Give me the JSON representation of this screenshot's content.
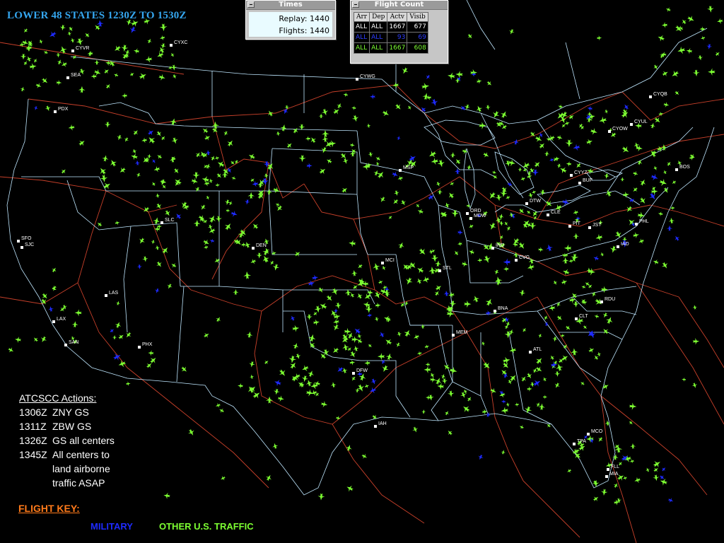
{
  "title": "LOWER 48 STATES 1230Z TO 1530Z",
  "colors": {
    "background": "#000000",
    "state_lines": "#bfe7ff",
    "center_lines": "#d2402b",
    "other_traffic": "#7dff32",
    "military": "#1e2bff",
    "title": "#35a7f0",
    "flight_key": "#ff7a1a"
  },
  "times_window": {
    "title": "Times",
    "replay_label": "Replay:",
    "replay_value": "1440",
    "flights_label": "Flights:",
    "flights_value": "1440"
  },
  "flight_count_window": {
    "title": "Flight Count",
    "headers": [
      "Arr",
      "Dep",
      "Actv",
      "Visib"
    ],
    "rows": [
      [
        "ALL",
        "ALL",
        "1667",
        "677"
      ],
      [
        "ALL",
        "ALL",
        "93",
        "69"
      ],
      [
        "ALL",
        "ALL",
        "1667",
        "608"
      ]
    ]
  },
  "airports": [
    "CYVR",
    "SEA",
    "CYXC",
    "CYWG",
    "PDX",
    "SFO",
    "SJC",
    "SLC",
    "LAS",
    "LAX",
    "SAN",
    "PHX",
    "DEN",
    "MSP",
    "ORD",
    "MDW",
    "DTW",
    "CLE",
    "PIT",
    "JST",
    "BOS",
    "PHL",
    "IAD",
    "CVG",
    "IND",
    "STL",
    "MCI",
    "BNA",
    "CLT",
    "RDU",
    "ATL",
    "MEM",
    "DFW",
    "IAH",
    "MCO",
    "TPA",
    "FLL",
    "MIA",
    "CYQB",
    "CYUL",
    "CYYZ",
    "CYOW",
    "BUF"
  ],
  "actions": {
    "title": "ATCSCC Actions:",
    "items": [
      {
        "time": "1306Z",
        "text": "ZNY GS"
      },
      {
        "time": "1311Z",
        "text": "ZBW GS"
      },
      {
        "time": "1326Z",
        "text": "GS all centers"
      },
      {
        "time": "1345Z",
        "text": "All centers to",
        "cont": [
          "land airborne",
          "traffic ASAP"
        ]
      }
    ]
  },
  "flight_key": {
    "title": "FLIGHT KEY:",
    "military": "MILITARY",
    "other": "OTHER U.S. TRAFFIC"
  }
}
